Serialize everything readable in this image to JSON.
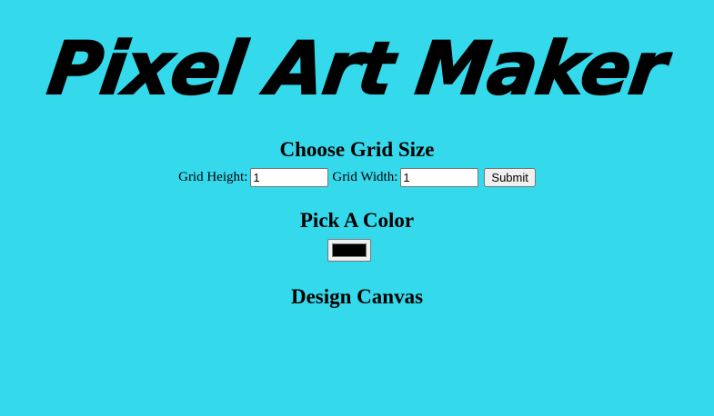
{
  "app": {
    "title": "Pixel Art Maker"
  },
  "grid_size": {
    "heading": "Choose Grid Size",
    "height_label": "Grid Height:",
    "height_value": "1",
    "width_label": "Grid Width:",
    "width_value": "1",
    "submit_label": "Submit"
  },
  "color": {
    "heading": "Pick A Color",
    "value": "#000000"
  },
  "canvas": {
    "heading": "Design Canvas"
  },
  "theme": {
    "background": "#35d9ec"
  }
}
